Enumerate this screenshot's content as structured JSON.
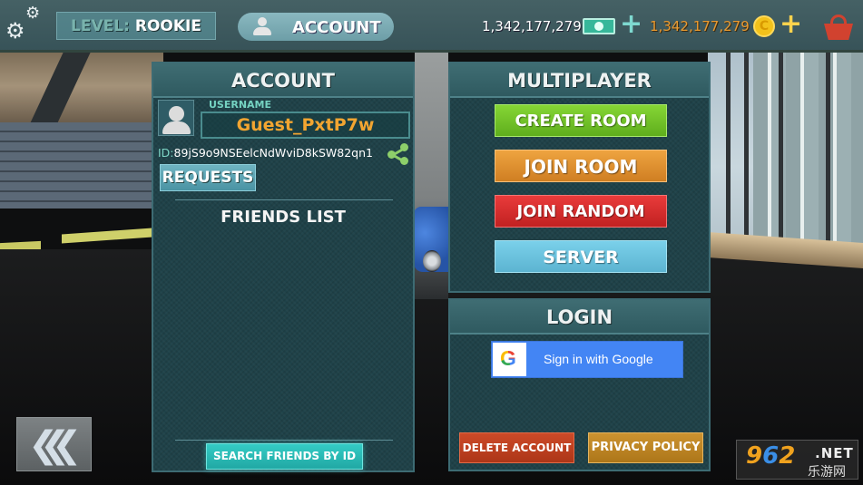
{
  "topbar": {
    "level_label": "LEVEL:",
    "level_value": "ROOKIE",
    "account_label": "ACCOUNT",
    "cash": "1,342,177,279",
    "coins": "1,342,177,279",
    "coin_symbol": "C",
    "plus": "+",
    "gear_symbol": "⚙"
  },
  "account_panel": {
    "title": "ACCOUNT",
    "username_label": "USERNAME",
    "username": "Guest_PxtP7w",
    "id_prefix": "ID:",
    "id_value": "89jS9o9NSEelcNdWviD8kSW82qn1",
    "requests_label": "REQUESTS",
    "friends_list_title": "FRIENDS LIST",
    "search_friends_label": "SEARCH FRIENDS BY ID"
  },
  "multiplayer_panel": {
    "title": "MULTIPLAYER",
    "buttons": [
      {
        "label": "CREATE ROOM",
        "color": "#6fc229"
      },
      {
        "label": "JOIN ROOM",
        "color": "#e0912f"
      },
      {
        "label": "JOIN RANDOM",
        "color": "#d52c2c"
      },
      {
        "label": "SERVER",
        "color": "#6cc3de"
      }
    ]
  },
  "login_panel": {
    "title": "LOGIN",
    "google_label": "Sign in with Google",
    "google_glyph": "G",
    "delete_account_label": "DELETE ACCOUNT",
    "privacy_policy_label": "PRIVACY POLICY"
  },
  "back_button": {
    "glyph": "❮"
  },
  "watermark": {
    "num_a": "9",
    "num_b": "6",
    "num_c": "2",
    "net": ".NET",
    "cn": "乐游网"
  },
  "colors": {
    "panel_bg": "#1f4249",
    "username": "#f2a531",
    "coins": "#e89a32",
    "cash_icon": "#37b79a",
    "shop": "#d1422f"
  }
}
